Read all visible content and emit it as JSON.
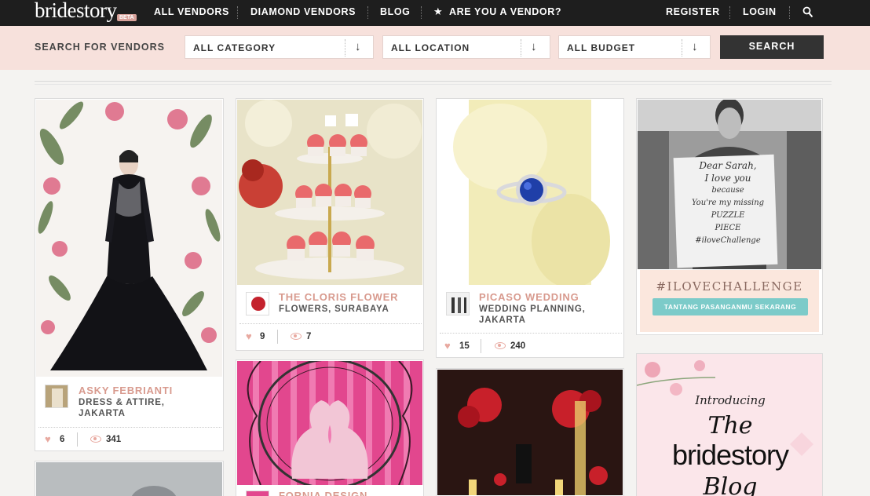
{
  "header": {
    "logo": "bridestory",
    "beta": "BETA",
    "nav": [
      "ALL VENDORS",
      "DIAMOND VENDORS",
      "BLOG",
      "ARE YOU A VENDOR?"
    ],
    "register": "REGISTER",
    "login": "LOGIN",
    "icons": [
      "star-icon",
      "search-icon"
    ]
  },
  "search": {
    "label": "SEARCH FOR VENDORS",
    "category": "ALL CATEGORY",
    "location": "ALL LOCATION",
    "budget": "ALL BUDGET",
    "button": "SEARCH"
  },
  "vendors": [
    {
      "name": "ASKY FEBRIANTI",
      "category": "DRESS & ATTIRE,",
      "city": "JAKARTA",
      "likes": "6",
      "views": "341"
    },
    {
      "name": "THE CLORIS FLOWER",
      "category": "FLOWERS, SURABAYA",
      "likes": "9",
      "views": "7"
    },
    {
      "name": "PICASO WEDDING",
      "category": "WEDDING PLANNING,",
      "city": "JAKARTA",
      "likes": "15",
      "views": "240"
    },
    {
      "name": "FORNIA DESIGN"
    }
  ],
  "promo1": {
    "sign_lines": [
      "Dear Sarah,",
      "I love you",
      "because",
      "You're my missing",
      "PUZZLE",
      "PIECE",
      "#iloveChallenge"
    ],
    "title": "#ILOVECHALLENGE",
    "cta": "TANTANG PASANGANMU SEKARANG"
  },
  "promo2": {
    "intro": "Introducing",
    "the": "The",
    "brand": "bridestory",
    "blog": "Blog"
  },
  "colors": {
    "accent": "#d89a8e",
    "topbar": "#1e1e1e",
    "search_bg": "#f7e1dc"
  }
}
